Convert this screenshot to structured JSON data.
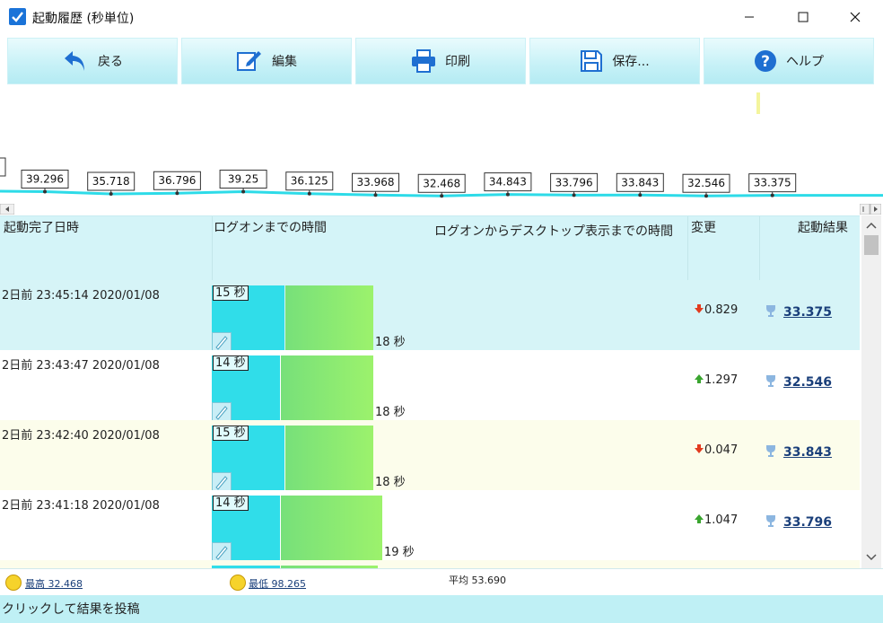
{
  "window": {
    "title": "起動履歴 (秒単位)"
  },
  "toolbar": {
    "back_label": "戻る",
    "edit_label": "編集",
    "print_label": "印刷",
    "save_label": "保存...",
    "help_label": "ヘルプ"
  },
  "chart_data": {
    "type": "line",
    "labels": [
      "39.296",
      "35.718",
      "36.796",
      "39.25",
      "36.125",
      "33.968",
      "32.468",
      "34.843",
      "33.796",
      "33.843",
      "32.546",
      "33.375"
    ],
    "values": [
      39.296,
      35.718,
      36.796,
      39.25,
      36.125,
      33.968,
      32.468,
      34.843,
      33.796,
      33.843,
      32.546,
      33.375
    ]
  },
  "grid": {
    "headers": {
      "date": "起動完了日時",
      "logon": "ログオンまでの時間",
      "desktop": "ログオンからデスクトップ表示までの時間",
      "change": "変更",
      "result": "起動結果"
    },
    "rows": [
      {
        "time": "2日前  23:45:14 2020/01/08",
        "logon": "15 秒",
        "total": "18 秒",
        "change": "0.829",
        "dir": "down",
        "result": "33.375",
        "logon_s": 15,
        "total_s": 18,
        "bg": "#d6f4f7"
      },
      {
        "time": "2日前  23:43:47 2020/01/08",
        "logon": "14 秒",
        "total": "18 秒",
        "change": "1.297",
        "dir": "up",
        "result": "32.546",
        "logon_s": 14,
        "total_s": 18,
        "bg": "#ffffff"
      },
      {
        "time": "2日前  23:42:40 2020/01/08",
        "logon": "15 秒",
        "total": "18 秒",
        "change": "0.047",
        "dir": "down",
        "result": "33.843",
        "logon_s": 15,
        "total_s": 18,
        "bg": "#fcfdeb"
      },
      {
        "time": "2日前  23:41:18 2020/01/08",
        "logon": "14 秒",
        "total": "19 秒",
        "change": "1.047",
        "dir": "up",
        "result": "33.796",
        "logon_s": 14,
        "total_s": 19,
        "bg": "#ffffff"
      }
    ]
  },
  "footer": {
    "best": "最高 32.468",
    "worst": "最低 98.265",
    "average": "平均 53.690",
    "status": "クリックして結果を投稿"
  },
  "colors": {
    "up": "#3aa52f",
    "down": "#e23b1f",
    "accent": "#2ddbe8"
  }
}
